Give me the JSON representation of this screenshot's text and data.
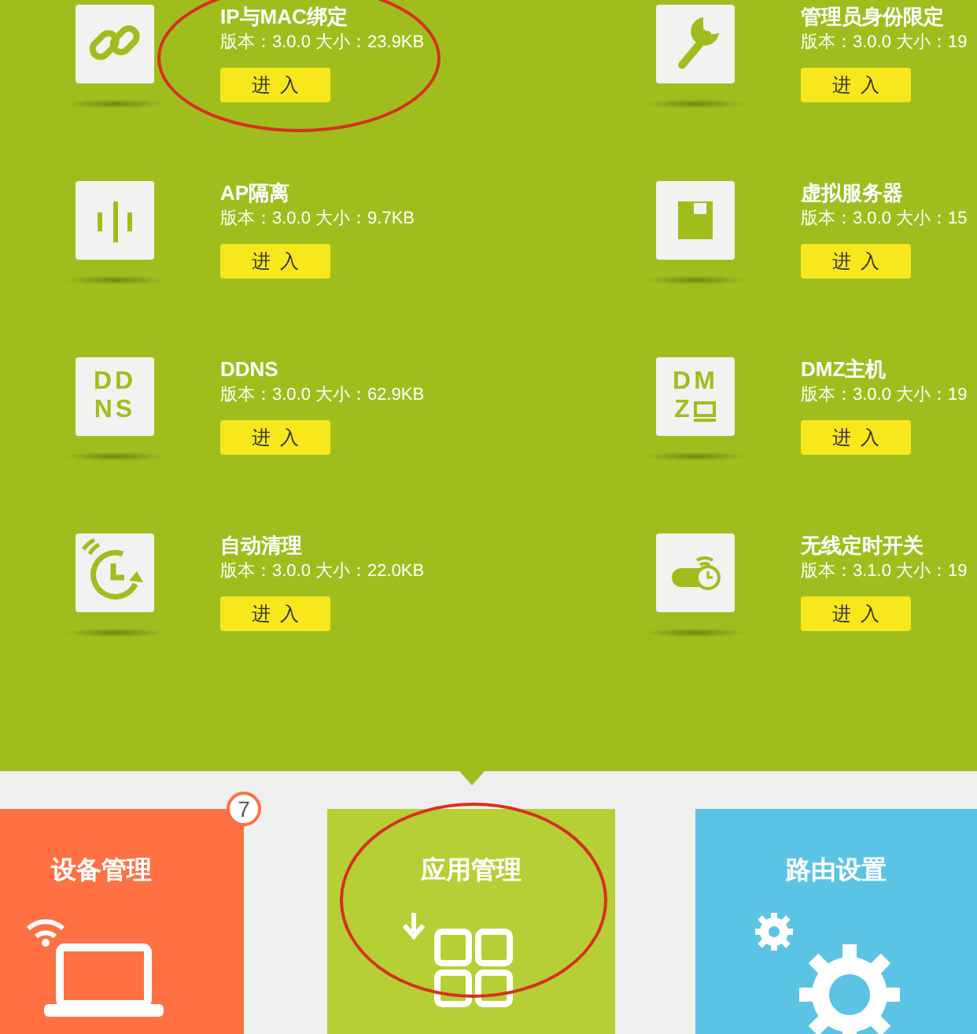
{
  "apps": [
    {
      "kind": "link",
      "title": "IP与MAC绑定",
      "info": "版本：3.0.0 大小：23.9KB",
      "button": "进入",
      "circled": true
    },
    {
      "kind": "wrench",
      "title": "管理员身份限定",
      "info": "版本：3.0.0 大小：19",
      "button": "进入",
      "circled": false
    },
    {
      "kind": "bars",
      "title": "AP隔离",
      "info": "版本：3.0.0 大小：9.7KB",
      "button": "进入",
      "circled": false
    },
    {
      "kind": "floppy",
      "title": "虚拟服务器",
      "info": "版本：3.0.0 大小：15",
      "button": "进入",
      "circled": false
    },
    {
      "kind": "ddns",
      "icon_text": [
        "DD",
        "NS"
      ],
      "title": "DDNS",
      "info": "版本：3.0.0 大小：62.9KB",
      "button": "进入",
      "circled": false
    },
    {
      "kind": "dmz",
      "icon_text": [
        "DM",
        "Z"
      ],
      "title": "DMZ主机",
      "info": "版本：3.0.0 大小：19",
      "button": "进入",
      "circled": false
    },
    {
      "kind": "clock",
      "title": "自动清理",
      "info": "版本：3.0.0 大小：22.0KB",
      "button": "进入",
      "circled": false
    },
    {
      "kind": "wifi-toggle",
      "title": "无线定时开关",
      "info": "版本：3.1.0 大小：19",
      "button": "进入",
      "circled": false
    }
  ],
  "tiles": [
    {
      "kind": "device",
      "label": "设备管理",
      "color": "#ff7043",
      "badge": "7",
      "selected": false,
      "circled": false
    },
    {
      "kind": "app",
      "label": "应用管理",
      "color": "#b5cf35",
      "selected": true,
      "circled": true
    },
    {
      "kind": "router",
      "label": "路由设置",
      "color": "#5bc4e5",
      "selected": false,
      "circled": false
    }
  ]
}
